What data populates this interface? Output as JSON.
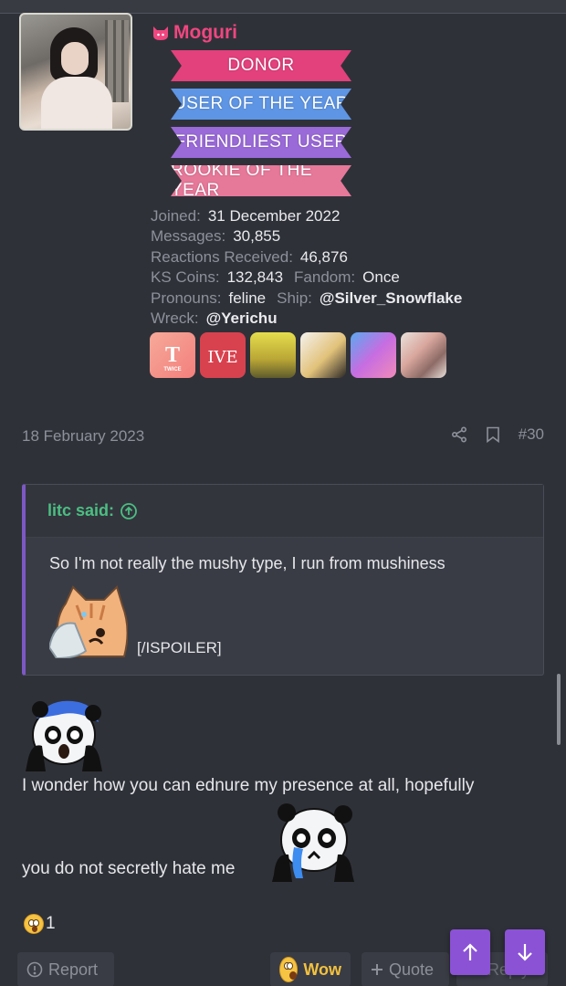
{
  "user": {
    "name": "Moguri",
    "icon": "cat-icon",
    "name_color": "#f0467f",
    "banners": [
      {
        "label": "DONOR",
        "color": "#e2417c"
      },
      {
        "label": "USER OF THE YEAR",
        "color": "#5e95e4"
      },
      {
        "label": "FRIENDLIEST USER",
        "color": "#9a6ad8"
      },
      {
        "label": "ROOKIE OF THE YEAR",
        "color": "#e6789a"
      }
    ],
    "stats": {
      "joined_label": "Joined:",
      "joined": "31 December 2022",
      "messages_label": "Messages:",
      "messages": "30,855",
      "reactions_label": "Reactions Received:",
      "reactions": "46,876",
      "coins_label": "KS Coins:",
      "coins": "132,843",
      "fandom_label": "Fandom:",
      "fandom": "Once",
      "pronouns_label": "Pronouns:",
      "pronouns": "feline",
      "ship_label": "Ship:",
      "ship": "@Silver_Snowflake",
      "wreck_label": "Wreck:",
      "wreck": "@Yerichu"
    },
    "badge_logos": {
      "twice": "TWICE",
      "ive": "IVE"
    }
  },
  "post": {
    "date": "18 February 2023",
    "number": "#30",
    "quote": {
      "author": "litc said:",
      "text": "So I'm not really the mushy type, I run from mushiness",
      "spoiler_tag": "[/ISPOILER]"
    },
    "line1": "I wonder how you can ednure my presence at all, hopefully",
    "line2": "you do not secretly hate me",
    "reaction_count": "1"
  },
  "actions": {
    "report": "Report",
    "wow": "Wow",
    "quote": "Quote",
    "reply": "Reply"
  },
  "colors": {
    "background": "#2f3139",
    "accent": "#8b52d6",
    "quote_author": "#4bbf82"
  }
}
